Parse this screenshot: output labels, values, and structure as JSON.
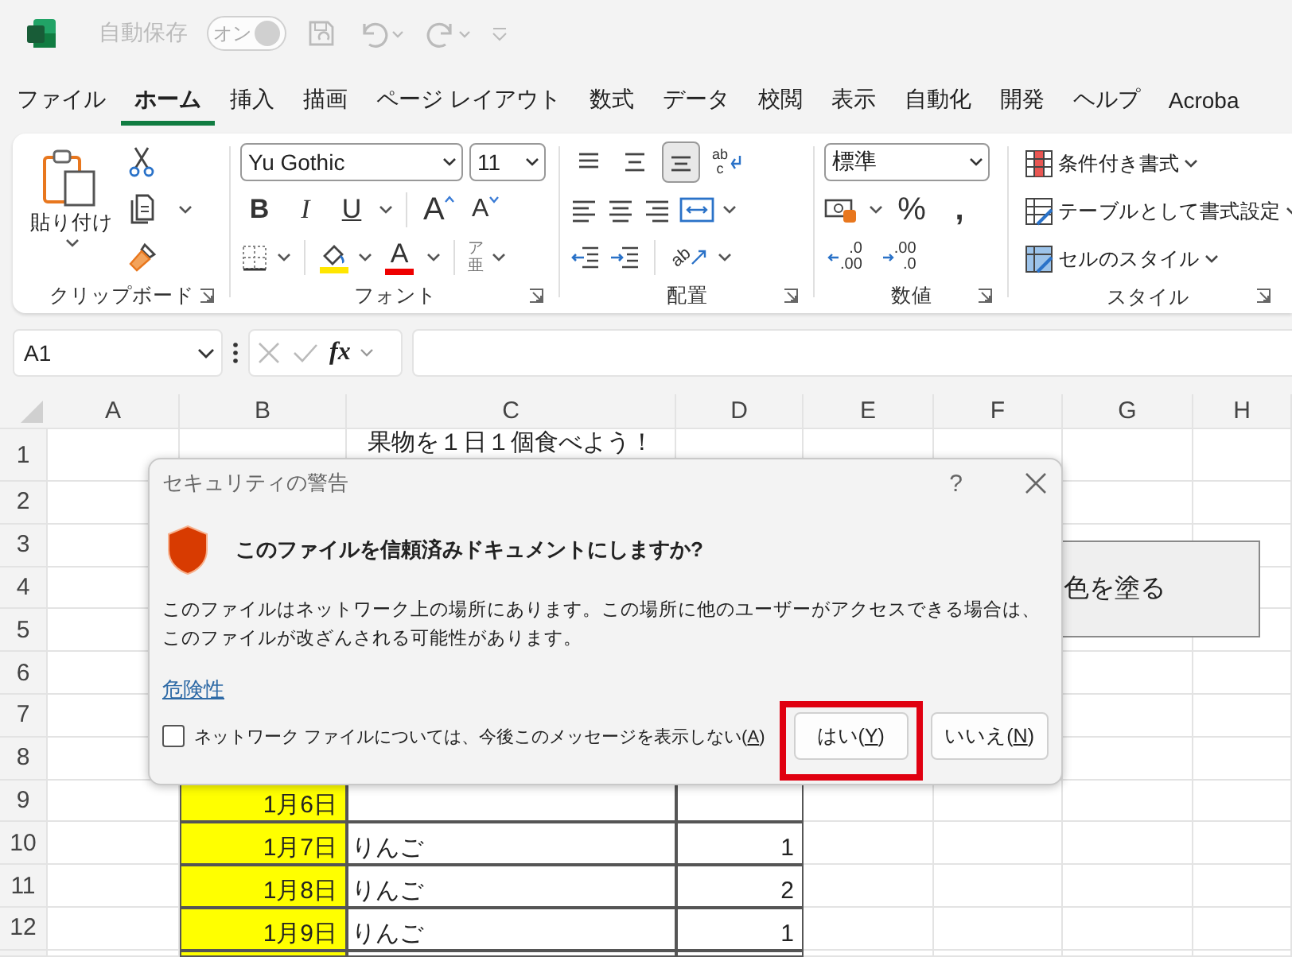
{
  "title_bar": {
    "autosave_label": "自動保存",
    "autosave_toggle": {
      "text": "オン",
      "on": true,
      "disabled": true
    }
  },
  "menu_tabs": [
    {
      "label": "ファイル",
      "selected": false
    },
    {
      "label": "ホーム",
      "selected": true
    },
    {
      "label": "挿入",
      "selected": false
    },
    {
      "label": "描画",
      "selected": false
    },
    {
      "label": "ページ レイアウト",
      "selected": false
    },
    {
      "label": "数式",
      "selected": false
    },
    {
      "label": "データ",
      "selected": false
    },
    {
      "label": "校閲",
      "selected": false
    },
    {
      "label": "表示",
      "selected": false
    },
    {
      "label": "自動化",
      "selected": false
    },
    {
      "label": "開発",
      "selected": false
    },
    {
      "label": "ヘルプ",
      "selected": false
    },
    {
      "label": "Acroba",
      "selected": false
    }
  ],
  "ribbon": {
    "clipboard": {
      "label": "クリップボード",
      "paste_label": "貼り付け"
    },
    "font": {
      "label": "フォント",
      "font_name": "Yu Gothic",
      "font_size": "11",
      "style_buttons": [
        {
          "kind": "bold",
          "glyph": "B"
        },
        {
          "kind": "italic",
          "glyph": "I"
        },
        {
          "kind": "underline",
          "glyph": "U"
        },
        {
          "kind": "grow",
          "glyph": "A"
        },
        {
          "kind": "shrink",
          "glyph": "A"
        }
      ],
      "font_color_glyph": "A",
      "phonetic_glyph": "ア亜"
    },
    "alignment": {
      "label": "配置",
      "vertical_buttons": [
        {
          "kind": "top",
          "selected": false
        },
        {
          "kind": "middle",
          "selected": false
        },
        {
          "kind": "bottom",
          "selected": true
        }
      ],
      "wrap_glyph": "abc",
      "orientation_glyph": "ab"
    },
    "number": {
      "label": "数値",
      "format": "標準",
      "percent_glyph": "%",
      "comma_glyph": ",",
      "decimal_buttons": [
        {
          "kind": "increase",
          "top": ".0",
          "bottom": ".00"
        },
        {
          "kind": "decrease",
          "top": ".00",
          "bottom": ".0"
        }
      ]
    },
    "styles": {
      "label": "スタイル",
      "buttons": [
        {
          "kind": "conditional",
          "label": "条件付き書式"
        },
        {
          "kind": "table",
          "label": "テーブルとして書式設定"
        },
        {
          "kind": "cell",
          "label": "セルのスタイル"
        }
      ]
    }
  },
  "formula_bar": {
    "name_box": "A1",
    "fx": "fx"
  },
  "sheet": {
    "columns": [
      "A",
      "B",
      "C",
      "D",
      "E",
      "F",
      "G",
      "H"
    ],
    "rows": [
      {
        "number": "1",
        "title": "果物を１日１個食べよう！"
      },
      {
        "number": "2"
      },
      {
        "number": "3"
      },
      {
        "number": "4"
      },
      {
        "number": "5"
      },
      {
        "number": "6"
      },
      {
        "number": "7"
      },
      {
        "number": "8"
      },
      {
        "number": "9",
        "date": "1月6日",
        "highlighted": true,
        "bordered": true
      },
      {
        "number": "10",
        "date": "1月7日",
        "fruit": "りんご",
        "count": "1",
        "highlighted": true,
        "bordered": true
      },
      {
        "number": "11",
        "date": "1月8日",
        "fruit": "りんご",
        "count": "2",
        "highlighted": true,
        "bordered": true
      },
      {
        "number": "12",
        "date": "1月9日",
        "fruit": "りんご",
        "count": "1",
        "highlighted": true,
        "bordered": true
      },
      {
        "highlighted": true,
        "bordered": true
      }
    ],
    "shape": {
      "text": "色を塗る"
    }
  },
  "dialog": {
    "title": "セキュリティの警告",
    "help_glyph": "?",
    "heading": "このファイルを信頼済みドキュメントにしますか?",
    "body": "このファイルはネットワーク上の場所にあります。この場所に他のユーザーがアクセスできる場合は、このファイルが改ざんされる可能性があります。",
    "link": "危険性",
    "checkbox": {
      "text": "ネットワーク ファイルについては、今後このメッセージを表示しない(",
      "key": "A",
      "tail": ")",
      "checked": false
    },
    "buttons": [
      {
        "text": "はい(",
        "key": "Y",
        "tail": ")",
        "highlighted": true
      },
      {
        "text": "いいえ(",
        "key": "N",
        "tail": ")",
        "highlighted": false
      }
    ]
  }
}
